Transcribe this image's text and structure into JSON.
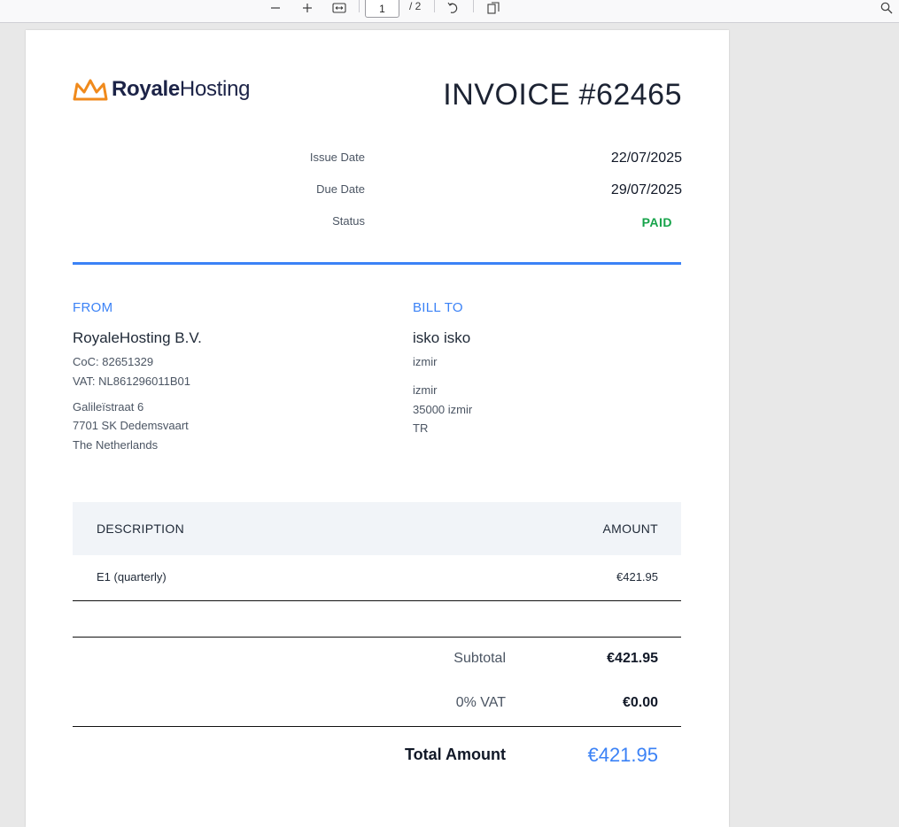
{
  "viewer": {
    "current_page": "1",
    "page_total": "/ 2",
    "icons": [
      "minus-icon",
      "plus-icon",
      "fit-width-icon",
      "rotate-icon",
      "pages-icon",
      "search-icon"
    ]
  },
  "invoice": {
    "brand_bold": "Royale",
    "brand_light": "Hosting",
    "title": "INVOICE #62465",
    "meta": [
      {
        "label": "Issue Date",
        "value": "22/07/2025"
      },
      {
        "label": "Due Date",
        "value": "29/07/2025"
      },
      {
        "label": "Status",
        "value": "PAID"
      }
    ],
    "from": {
      "heading": "FROM",
      "name": "RoyaleHosting B.V.",
      "coc": "CoC: 82651329",
      "vat": "VAT: NL861296011B01",
      "address1": "Galileïstraat 6",
      "address2": "7701 SK Dedemsvaart",
      "address3": "The Netherlands"
    },
    "bill_to": {
      "heading": "BILL TO",
      "name": "isko isko",
      "line1": "izmir",
      "line2": "izmir",
      "line3": "35000 izmir",
      "line4": "TR"
    },
    "table": {
      "col_description": "DESCRIPTION",
      "col_amount": "AMOUNT",
      "rows": [
        {
          "description": "E1 (quarterly)",
          "amount": "€421.95"
        }
      ]
    },
    "summary": {
      "subtotal_label": "Subtotal",
      "subtotal_value": "€421.95",
      "vat_label": "0% VAT",
      "vat_value": "€0.00",
      "total_label": "Total Amount",
      "total_value": "€421.95"
    },
    "colors": {
      "accent": "#3b82f6",
      "paid": "#16a34a",
      "brand": "#1c2347",
      "logo": "#f08a1c"
    }
  }
}
